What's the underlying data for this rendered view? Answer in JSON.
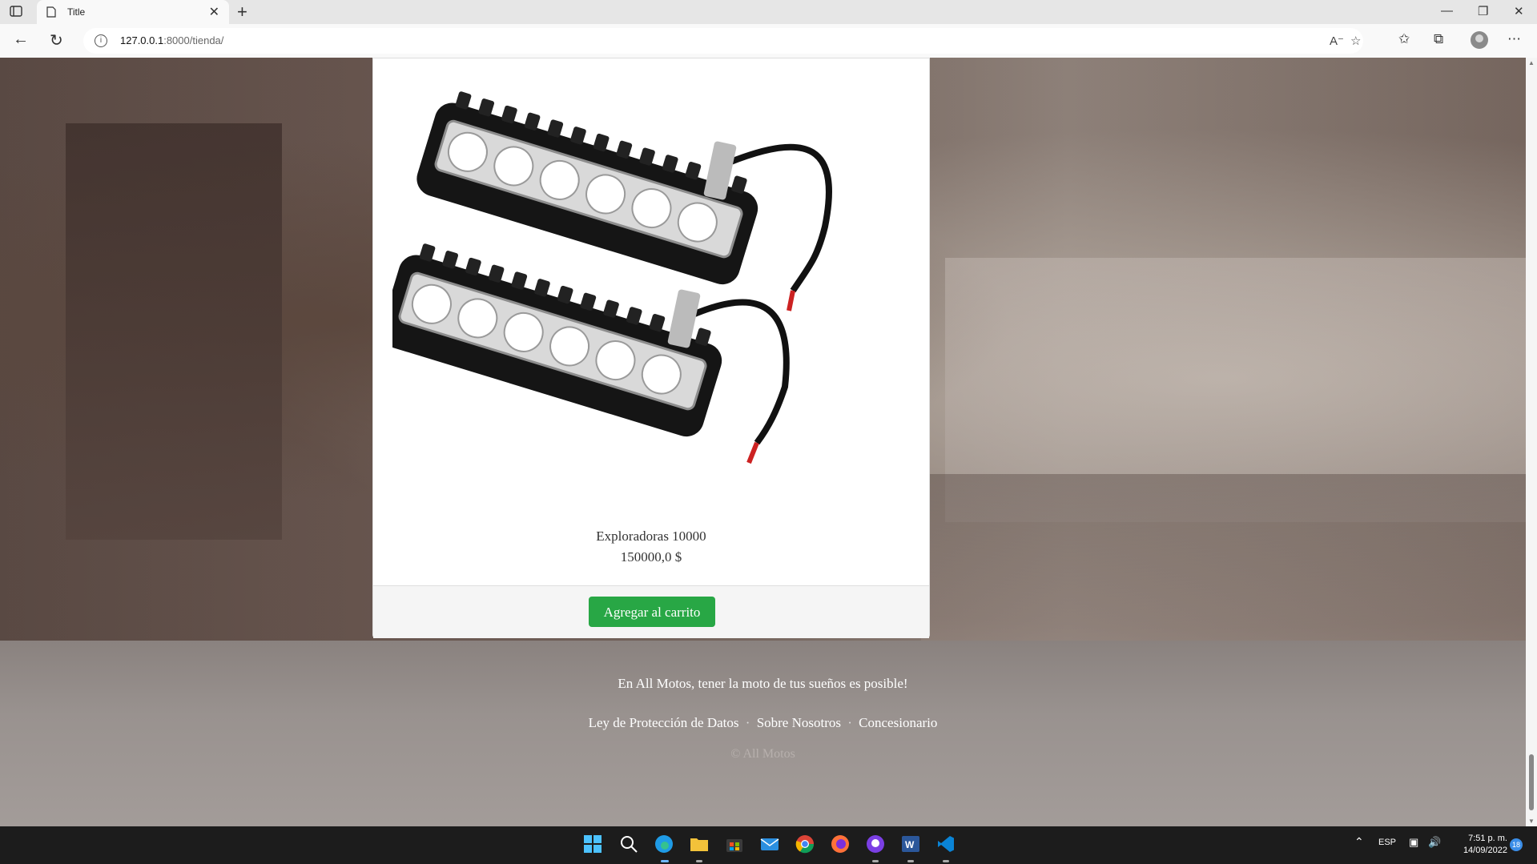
{
  "browser": {
    "tab_title": "Title",
    "url_host": "127.0.0.1",
    "url_path": ":8000/tienda/",
    "new_tab_glyph": "+",
    "close_glyph": "✕"
  },
  "product": {
    "name": "Exploradoras 10000",
    "price": "150000,0 $",
    "add_to_cart_label": "Agregar al carrito",
    "image_label": "A20161001-A"
  },
  "footer": {
    "tagline": "En All Motos, tener la moto de tus sueños es posible!",
    "links": [
      "Ley de Protección de Datos",
      "Sobre Nosotros",
      "Concesionario"
    ],
    "copyright": "© All Motos"
  },
  "taskbar": {
    "language": "ESP",
    "time": "7:51 p. m.",
    "date": "14/09/2022",
    "notification_count": "18",
    "apps": [
      "start-icon",
      "search-icon",
      "edge-icon",
      "file-explorer-icon",
      "store-icon",
      "mail-icon",
      "chrome-icon",
      "firefox-icon",
      "github-icon",
      "word-icon",
      "vscode-icon"
    ]
  },
  "colors": {
    "button_green": "#28a745",
    "taskbar": "#1c1c1c",
    "notification_blue": "#3b8ee8"
  }
}
